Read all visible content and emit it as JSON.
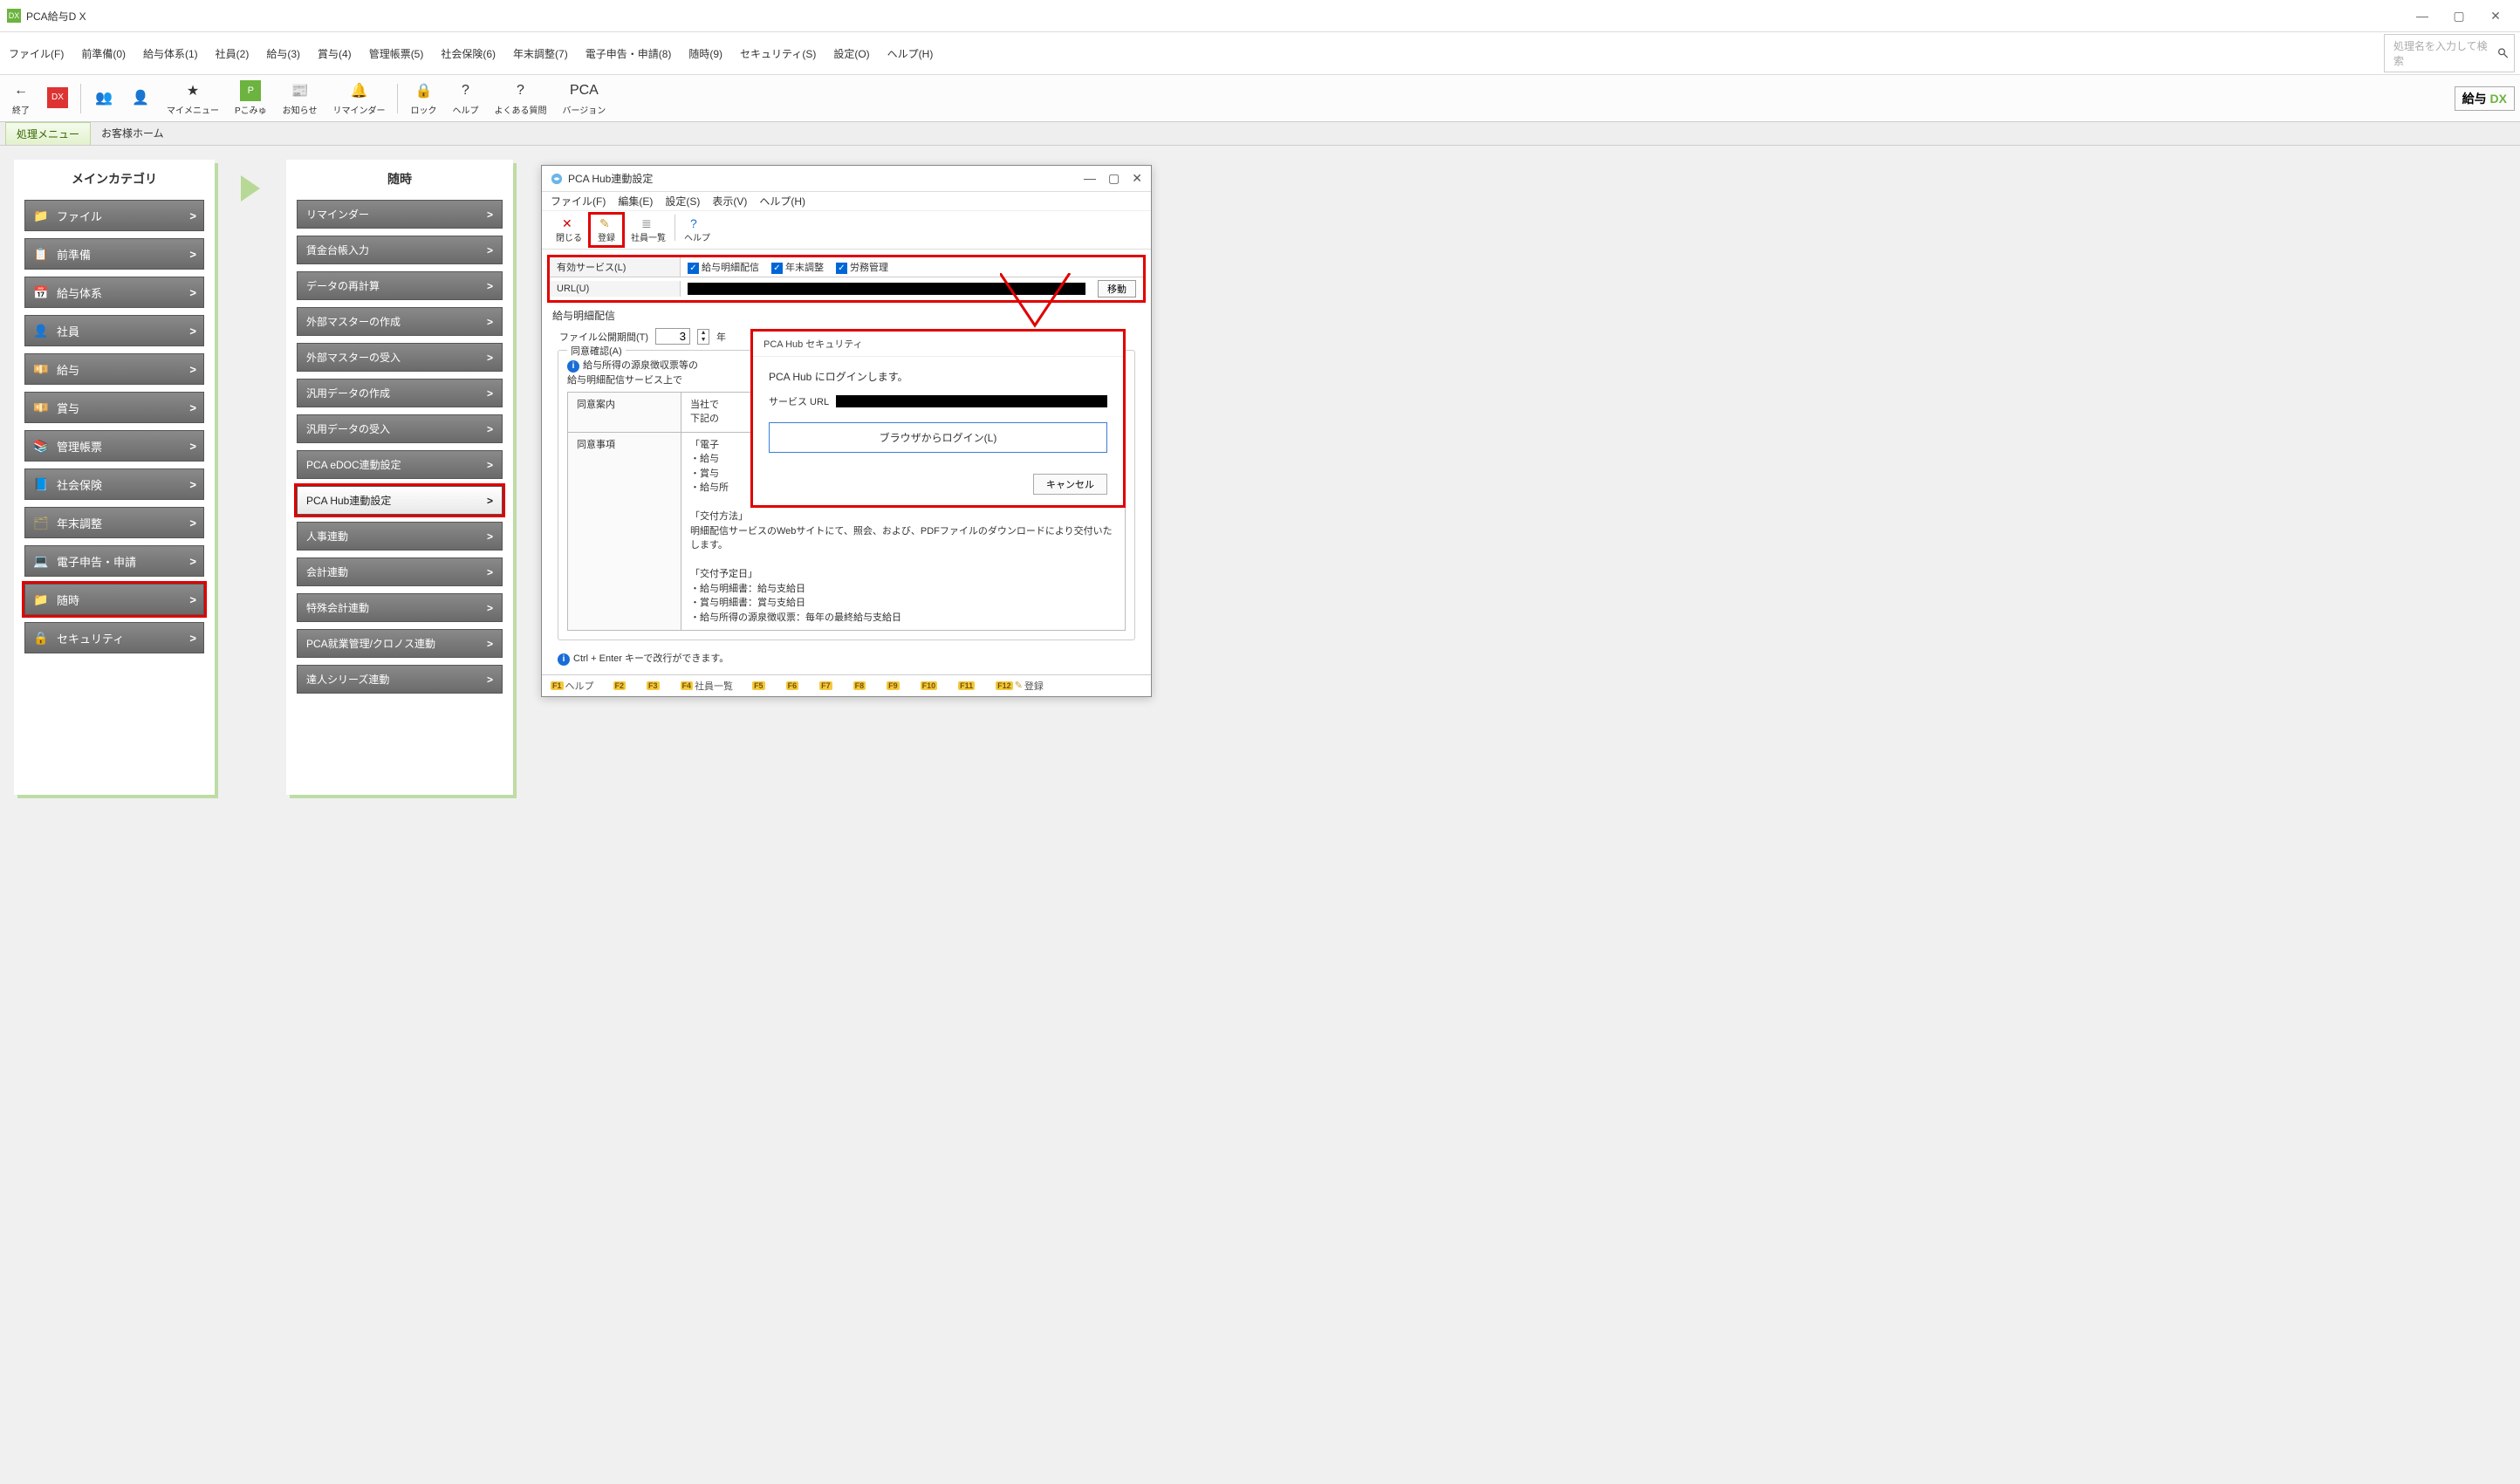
{
  "window": {
    "title": "PCA給与D X"
  },
  "menus": [
    "ファイル(F)",
    "前準備(0)",
    "給与体系(1)",
    "社員(2)",
    "給与(3)",
    "賞与(4)",
    "管理帳票(5)",
    "社会保険(6)",
    "年末調整(7)",
    "電子申告・申請(8)",
    "随時(9)",
    "セキュリティ(S)",
    "設定(O)",
    "ヘルプ(H)"
  ],
  "search_placeholder": "処理名を入力して検索",
  "toolbar": [
    {
      "label": "終了",
      "icon": "←"
    },
    {
      "label": "",
      "icon": "DX",
      "sep_after": true
    },
    {
      "label": "",
      "icon": "👥"
    },
    {
      "label": "",
      "icon": "👤"
    },
    {
      "label": "マイメニュー",
      "icon": "★"
    },
    {
      "label": "Pこみゅ",
      "icon": "P"
    },
    {
      "label": "お知らせ",
      "icon": "📰"
    },
    {
      "label": "リマインダー",
      "icon": "🔔",
      "sep_after": true
    },
    {
      "label": "ロック",
      "icon": "🔒"
    },
    {
      "label": "ヘルプ",
      "icon": "?"
    },
    {
      "label": "よくある質問",
      "icon": "?"
    },
    {
      "label": "バージョン",
      "icon": "PCA"
    }
  ],
  "brand_prefix": "給与",
  "brand_suffix": "DX",
  "tabs": [
    "処理メニュー",
    "お客様ホーム"
  ],
  "main_heading": "メインカテゴリ",
  "main_items": [
    {
      "label": "ファイル",
      "icon": "📁",
      "color": "#e6a23c"
    },
    {
      "label": "前準備",
      "icon": "📋",
      "color": "#c9a36a"
    },
    {
      "label": "給与体系",
      "icon": "📅",
      "color": "#888"
    },
    {
      "label": "社員",
      "icon": "👤",
      "color": "#d9d0b8"
    },
    {
      "label": "給与",
      "icon": "💴",
      "color": "#d4b24a"
    },
    {
      "label": "賞与",
      "icon": "💴",
      "color": "#d4b24a"
    },
    {
      "label": "管理帳票",
      "icon": "📚",
      "color": "#8a3a2f"
    },
    {
      "label": "社会保険",
      "icon": "📘",
      "color": "#3a6aa8"
    },
    {
      "label": "年末調整",
      "icon": "🗂",
      "color": "#b8a36a"
    },
    {
      "label": "電子申告・申請",
      "icon": "💻",
      "color": "#8899aa"
    },
    {
      "label": "随時",
      "icon": "📁",
      "color": "#3a6aa8",
      "highlight": true
    },
    {
      "label": "セキュリティ",
      "icon": "🔒",
      "color": "#c4a24a"
    }
  ],
  "sub_heading": "随時",
  "sub_items": [
    "リマインダー",
    "賃金台帳入力",
    "データの再計算",
    "外部マスターの作成",
    "外部マスターの受入",
    "汎用データの作成",
    "汎用データの受入",
    "PCA eDOC連動設定",
    "PCA Hub連動設定",
    "人事連動",
    "会計連動",
    "特殊会計連動",
    "PCA就業管理/クロノス連動",
    "達人シリーズ連動"
  ],
  "sub_selected_index": 8,
  "dialog": {
    "title": "PCA Hub連動設定",
    "menus": [
      "ファイル(F)",
      "編集(E)",
      "設定(S)",
      "表示(V)",
      "ヘルプ(H)"
    ],
    "toolbar": [
      {
        "label": "閉じる",
        "icon": "✕",
        "color": "#c00"
      },
      {
        "label": "登録",
        "icon": "✎",
        "color": "#c79b2e",
        "hl": true
      },
      {
        "label": "社員一覧",
        "icon": "≣",
        "color": "#888"
      },
      {
        "label": "ヘルプ",
        "icon": "?",
        "color": "#1a6dd6",
        "sep_before": true
      }
    ],
    "svc_label": "有効サービス(L)",
    "svc_opts": [
      "給与明細配信",
      "年末調整",
      "労務管理"
    ],
    "url_label": "URL(U)",
    "move_btn": "移動",
    "section": "給与明細配信",
    "period_label": "ファイル公開期間(T)",
    "period_value": "3",
    "period_unit": "年",
    "consent_group": "同意確認(A)",
    "consent_info": "給与所得の源泉徴収票等の\n給与明細配信サービス上で",
    "consent_rows": [
      {
        "k": "同意案内",
        "v": "当社で\n下記の"
      },
      {
        "k": "同意事項",
        "v": "「電子\n・給与\n・賞与\n・給与所\n\n「交付方法」\n明細配信サービスのWebサイトにて、照会、および、PDFファイルのダウンロードにより交付いたします。\n\n「交付予定日」\n・給与明細書：給与支給日\n・賞与明細書：賞与支給日\n・給与所得の源泉徴収票：毎年の最終給与支給日"
      }
    ],
    "hint": "Ctrl + Enter キーで改行ができます。",
    "status": [
      {
        "key": "F1",
        "label": "ヘルプ"
      },
      {
        "key": "F2",
        "label": ""
      },
      {
        "key": "F3",
        "label": ""
      },
      {
        "key": "F4",
        "label": "社員一覧"
      },
      {
        "key": "F5",
        "label": ""
      },
      {
        "key": "F6",
        "label": ""
      },
      {
        "key": "F7",
        "label": ""
      },
      {
        "key": "F8",
        "label": ""
      },
      {
        "key": "F9",
        "label": ""
      },
      {
        "key": "F10",
        "label": ""
      },
      {
        "key": "F11",
        "label": ""
      },
      {
        "key": "F12",
        "label": "登録",
        "icon": "✎"
      }
    ]
  },
  "security": {
    "title": "PCA Hub セキュリティ",
    "message": "PCA Hub にログインします。",
    "svc_label": "サービス URL",
    "login_btn": "ブラウザからログイン(L)",
    "cancel": "キャンセル"
  }
}
